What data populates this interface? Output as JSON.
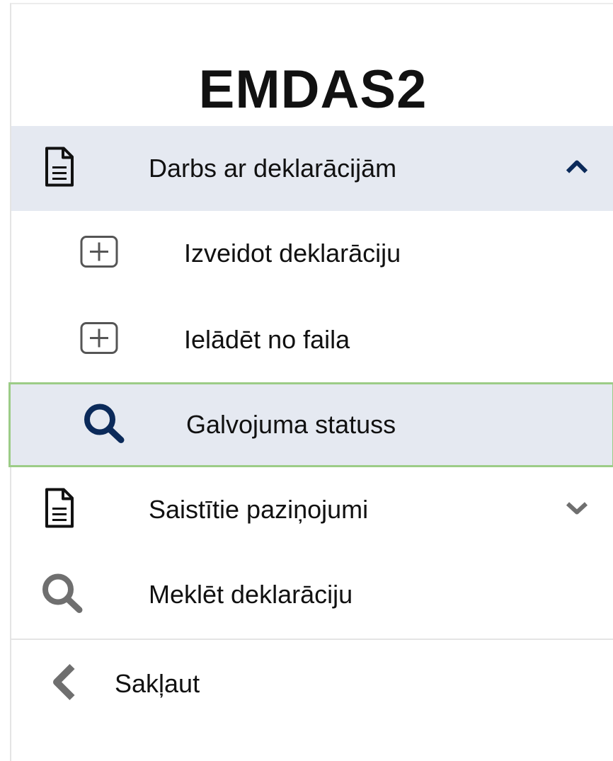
{
  "app_title": "EMDAS2",
  "menu": {
    "declarations": {
      "label": "Darbs ar deklarācijām",
      "icon": "document-icon",
      "state": "expanded"
    },
    "create": {
      "label": "Izveidot deklarāciju",
      "icon": "plus-box-icon"
    },
    "upload": {
      "label": "Ielādēt no faila",
      "icon": "plus-box-icon"
    },
    "guarantee": {
      "label": "Galvojuma statuss",
      "icon": "search-icon",
      "selected": true
    },
    "linked": {
      "label": "Saistītie paziņojumi",
      "icon": "document-icon",
      "state": "collapsed"
    },
    "search": {
      "label": "Meklēt deklarāciju",
      "icon": "search-icon"
    },
    "collapse": {
      "label": "Sakļaut",
      "icon": "chevron-left-icon"
    }
  },
  "colors": {
    "highlight_bg": "#e5e9f1",
    "selected_border": "#9ccc87",
    "accent_icon": "#0b2a5a",
    "muted_icon": "#6f6f6f"
  }
}
